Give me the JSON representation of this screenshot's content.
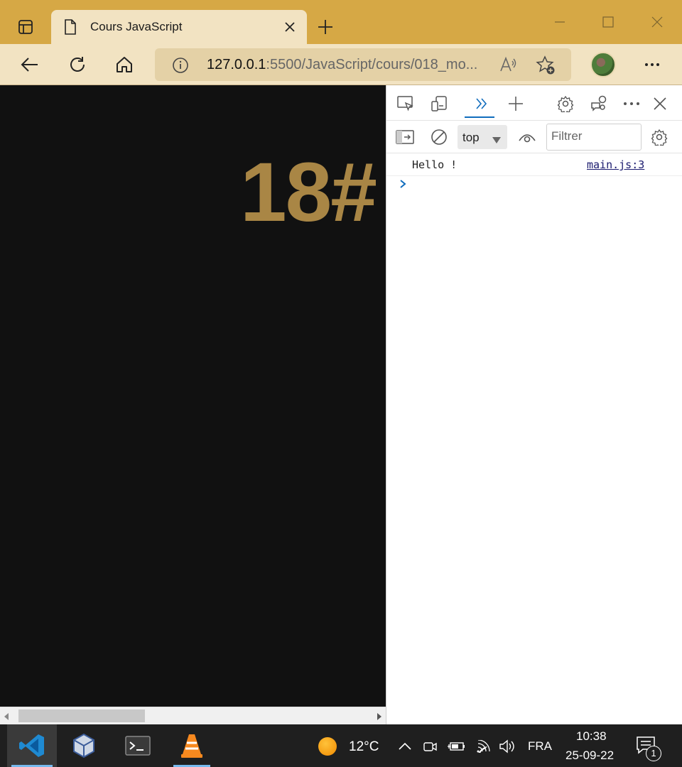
{
  "browser": {
    "tab": {
      "title": "Cours JavaScript"
    },
    "address": {
      "host": "127.0.0.1",
      "rest": ":5500/JavaScript/cours/018_mo..."
    }
  },
  "page": {
    "heading": "18#"
  },
  "devtools": {
    "context": "top",
    "filter_placeholder": "Filtrer",
    "console": [
      {
        "message": "Hello !",
        "source": "main.js:3"
      }
    ]
  },
  "taskbar": {
    "apps": [
      "vscode-icon",
      "virtualbox-icon",
      "terminal-icon",
      "vlc-icon"
    ],
    "weather": {
      "temp": "12°C"
    },
    "language": "FRA",
    "clock": {
      "time": "10:38",
      "date": "25-09-22"
    },
    "notifications": "1"
  },
  "colors": {
    "titlebar": "#d6a845",
    "toolbar": "#f2e3c2",
    "heading": "#a98645",
    "devtools_accent": "#0f6cbd"
  }
}
